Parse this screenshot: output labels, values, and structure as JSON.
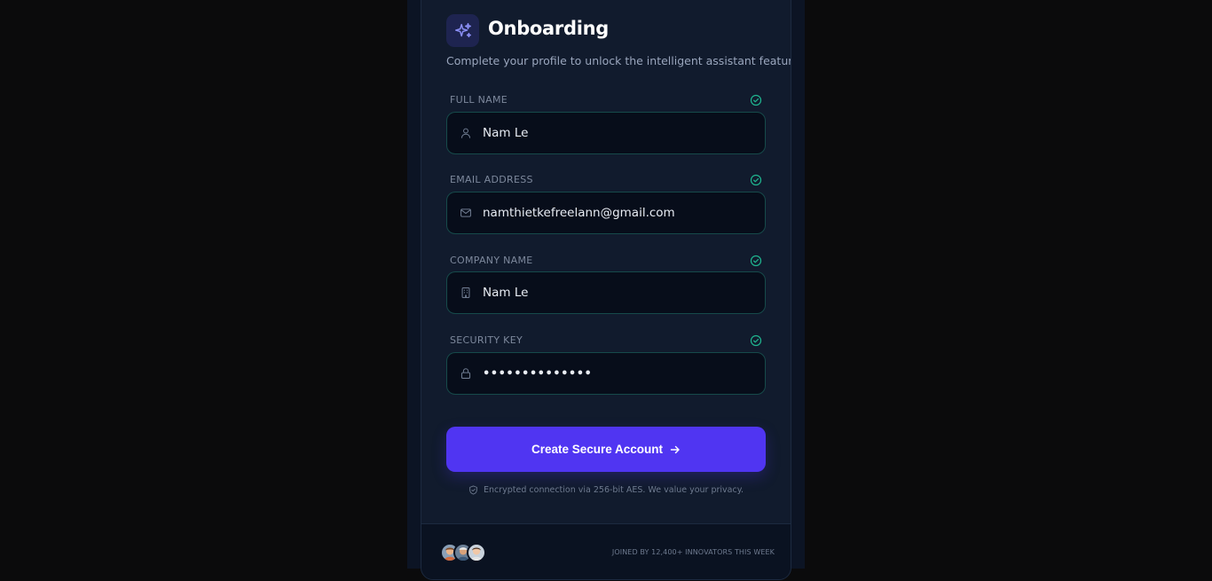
{
  "header": {
    "title": "Onboarding",
    "subtitle": "Complete your profile to unlock the intelligent assistant features.",
    "icon": "sparkles-icon"
  },
  "form": {
    "full_name": {
      "label": "FULL NAME",
      "value": "Nam Le",
      "icon": "user-icon"
    },
    "email": {
      "label": "EMAIL ADDRESS",
      "value": "namthietkefreelann@gmail.com",
      "icon": "mail-icon"
    },
    "company": {
      "label": "COMPANY NAME",
      "value": "Nam Le",
      "icon": "building-icon"
    },
    "security_key": {
      "label": "SECURITY KEY",
      "value": "••••••••••••••",
      "icon": "lock-icon"
    }
  },
  "cta": {
    "label": "Create Secure Account",
    "icon": "arrow-right-icon"
  },
  "secure_note": "Encrypted connection via 256-bit AES. We value your privacy.",
  "footer": {
    "joined_text": "JOINED BY 12,400+ INNOVATORS THIS WEEK"
  },
  "colors": {
    "accent": "#5035f2",
    "valid": "#1fb58f",
    "background": "#111b2d",
    "input_border": "#164a4a"
  }
}
